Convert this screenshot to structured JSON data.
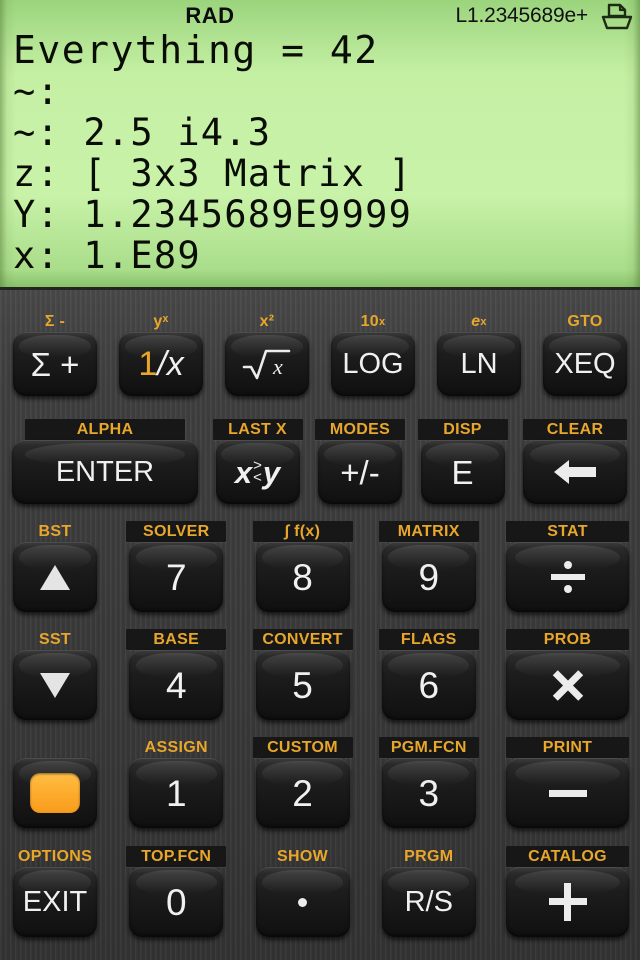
{
  "display": {
    "angle_mode": "RAD",
    "annunciator": "L1.2345689e+",
    "printer_icon": "printer-icon",
    "stack": [
      {
        "label": "",
        "text": "Everything = 42"
      },
      {
        "label": "",
        "text": "~:"
      },
      {
        "label": "",
        "text": "~: 2.5 i4.3"
      },
      {
        "label": "",
        "text": "z: [ 3x3 Matrix ]"
      },
      {
        "label": "",
        "text": "Y: 1.2345689E9999"
      },
      {
        "label": "",
        "text": "x: 1.E89"
      }
    ],
    "background_color": "#c8f2a8",
    "text_color": "#0a0c06"
  },
  "keypad": {
    "accent_color": "#e8a62b",
    "key_color": "#1a1a1a",
    "rows": [
      {
        "keys": [
          {
            "shift": "Σ -",
            "shift_style": "plain",
            "label": "Σ +",
            "icon": "sigma-plus-key",
            "name": "key-sigma-plus"
          },
          {
            "shift": "yˣ",
            "shift_style": "plain",
            "label": "1/x",
            "icon": "reciprocal-key",
            "name": "key-reciprocal"
          },
          {
            "shift": "x²",
            "shift_style": "plain",
            "label": "√x",
            "icon": "square-root-key",
            "name": "key-sqrt"
          },
          {
            "shift": "10ˣ",
            "shift_style": "plain",
            "label": "LOG",
            "icon": "log-key",
            "name": "key-log"
          },
          {
            "shift": "eˣ",
            "shift_style": "plain",
            "label": "LN",
            "icon": "ln-key",
            "name": "key-ln"
          },
          {
            "shift": "GTO",
            "shift_style": "plain",
            "label": "XEQ",
            "icon": "xeq-key",
            "name": "key-xeq"
          }
        ]
      },
      {
        "keys": [
          {
            "shift": "ALPHA",
            "shift_style": "boxed",
            "label": "ENTER",
            "icon": "enter-key",
            "name": "key-enter"
          },
          {
            "shift": "LAST X",
            "shift_style": "boxed",
            "label": "x≶y",
            "icon": "swap-xy-key",
            "name": "key-swap-xy"
          },
          {
            "shift": "MODES",
            "shift_style": "boxed",
            "label": "+/-",
            "icon": "sign-change-key",
            "name": "key-sign-change"
          },
          {
            "shift": "DISP",
            "shift_style": "boxed",
            "label": "E",
            "icon": "exponent-key",
            "name": "key-exponent"
          },
          {
            "shift": "CLEAR",
            "shift_style": "boxed",
            "label": "←",
            "icon": "backspace-key",
            "name": "key-backspace"
          }
        ]
      },
      {
        "keys": [
          {
            "shift": "BST",
            "shift_style": "plain",
            "label": "▲",
            "icon": "arrow-up-key",
            "name": "key-up"
          },
          {
            "shift": "SOLVER",
            "shift_style": "boxed",
            "label": "7",
            "icon": "digit-key",
            "name": "key-7"
          },
          {
            "shift": "∫ f(x)",
            "shift_style": "boxed",
            "label": "8",
            "icon": "digit-key",
            "name": "key-8"
          },
          {
            "shift": "MATRIX",
            "shift_style": "boxed",
            "label": "9",
            "icon": "digit-key",
            "name": "key-9"
          },
          {
            "shift": "STAT",
            "shift_style": "boxed",
            "label": "÷",
            "icon": "divide-key",
            "name": "key-divide"
          }
        ]
      },
      {
        "keys": [
          {
            "shift": "SST",
            "shift_style": "plain",
            "label": "▼",
            "icon": "arrow-down-key",
            "name": "key-down"
          },
          {
            "shift": "BASE",
            "shift_style": "boxed",
            "label": "4",
            "icon": "digit-key",
            "name": "key-4"
          },
          {
            "shift": "CONVERT",
            "shift_style": "boxed",
            "label": "5",
            "icon": "digit-key",
            "name": "key-5"
          },
          {
            "shift": "FLAGS",
            "shift_style": "boxed",
            "label": "6",
            "icon": "digit-key",
            "name": "key-6"
          },
          {
            "shift": "PROB",
            "shift_style": "boxed",
            "label": "×",
            "icon": "multiply-key",
            "name": "key-multiply"
          }
        ]
      },
      {
        "keys": [
          {
            "shift": "",
            "shift_style": "empty",
            "label": "",
            "icon": "shift-key",
            "name": "key-shift"
          },
          {
            "shift": "ASSIGN",
            "shift_style": "plain",
            "label": "1",
            "icon": "digit-key",
            "name": "key-1"
          },
          {
            "shift": "CUSTOM",
            "shift_style": "boxed",
            "label": "2",
            "icon": "digit-key",
            "name": "key-2"
          },
          {
            "shift": "PGM.FCN",
            "shift_style": "boxed",
            "label": "3",
            "icon": "digit-key",
            "name": "key-3"
          },
          {
            "shift": "PRINT",
            "shift_style": "boxed",
            "label": "−",
            "icon": "minus-key",
            "name": "key-minus"
          }
        ]
      },
      {
        "keys": [
          {
            "shift": "OPTIONS",
            "shift_style": "plain",
            "label": "EXIT",
            "icon": "exit-key",
            "name": "key-exit"
          },
          {
            "shift": "TOP.FCN",
            "shift_style": "boxed",
            "label": "0",
            "icon": "digit-key",
            "name": "key-0"
          },
          {
            "shift": "SHOW",
            "shift_style": "plain",
            "label": "·",
            "icon": "decimal-point-key",
            "name": "key-decimal"
          },
          {
            "shift": "PRGM",
            "shift_style": "plain",
            "label": "R/S",
            "icon": "run-stop-key",
            "name": "key-run-stop"
          },
          {
            "shift": "CATALOG",
            "shift_style": "boxed",
            "label": "+",
            "icon": "plus-key",
            "name": "key-plus"
          }
        ]
      }
    ]
  }
}
